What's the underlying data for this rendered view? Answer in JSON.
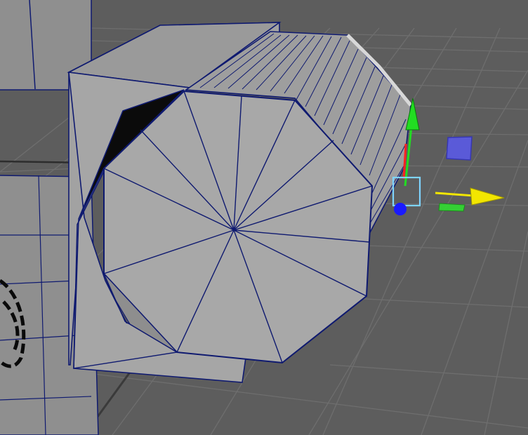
{
  "viewport": {
    "background": "#5d5d5d",
    "grid_color": "#6e6e6e",
    "grid_axis_color": "#2d2d2d",
    "wire_color": "#0f1a70",
    "face_color": "#a8a8a8",
    "face_shadow": "#8e8e8e",
    "face_dark": "#0b0b0b"
  },
  "gizmo": {
    "x_axis_color": "#f2e600",
    "y_axis_color": "#22dd22",
    "z_axis_color": "#1a1aff",
    "center_box_color": "#7ed4ff",
    "plane_xz_color": "#5a5aee",
    "plane_xy_color": "#30dd30",
    "red_axis_color": "#ff2222",
    "icons": [
      "move-x-arrow-icon",
      "move-y-arrow-icon",
      "move-z-handle-icon",
      "center-box-icon",
      "xz-plane-handle-icon",
      "xy-plane-handle-icon"
    ]
  }
}
